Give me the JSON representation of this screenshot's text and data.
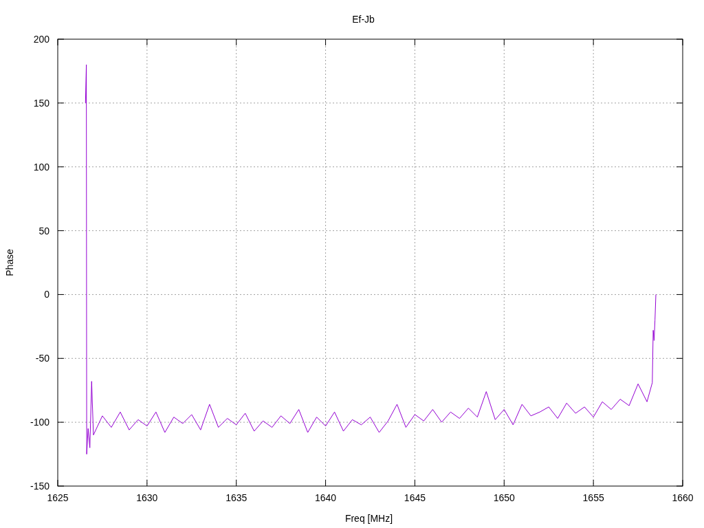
{
  "chart_data": {
    "type": "line",
    "title": "Ef-Jb",
    "xlabel": "Freq [MHz]",
    "ylabel": "Phase",
    "xlim": [
      1625,
      1660
    ],
    "grid": true,
    "ylim": [
      -150,
      200
    ],
    "xticks": [
      1625,
      1630,
      1635,
      1640,
      1645,
      1650,
      1655,
      1660
    ],
    "yticks": [
      -150,
      -100,
      -50,
      0,
      50,
      100,
      150,
      200
    ],
    "x": [
      1626.55,
      1626.6,
      1626.62,
      1626.7,
      1626.8,
      1626.9,
      1627.0,
      1627.5,
      1628,
      1628.5,
      1629,
      1629.5,
      1630,
      1630.5,
      1631,
      1631.5,
      1632,
      1632.5,
      1633,
      1633.5,
      1634,
      1634.5,
      1635,
      1635.5,
      1636,
      1636.5,
      1637,
      1637.5,
      1638,
      1638.5,
      1639,
      1639.5,
      1640,
      1640.5,
      1641,
      1641.5,
      1642,
      1642.5,
      1643,
      1643.5,
      1644,
      1644.5,
      1645,
      1645.5,
      1646,
      1646.5,
      1647,
      1647.5,
      1648,
      1648.5,
      1649,
      1649.5,
      1650,
      1650.5,
      1651,
      1651.5,
      1652,
      1652.5,
      1653,
      1653.5,
      1654,
      1654.5,
      1655,
      1655.5,
      1656,
      1656.5,
      1657,
      1657.5,
      1658,
      1658.3,
      1658.35,
      1658.4,
      1658.45,
      1658.5
    ],
    "series": [
      {
        "color": "#9400d3",
        "values": [
          150,
          180,
          -125,
          -105,
          -120,
          -68,
          -110,
          -95,
          -104,
          -92,
          -106,
          -98,
          -103,
          -92,
          -108,
          -96,
          -101,
          -94,
          -106,
          -86,
          -104,
          -97,
          -102,
          -93,
          -107,
          -99,
          -104,
          -95,
          -101,
          -90,
          -108,
          -96,
          -103,
          -92,
          -107,
          -98,
          -102,
          -96,
          -108,
          -99,
          -86,
          -104,
          -94,
          -99,
          -90,
          -100,
          -92,
          -97,
          -89,
          -96,
          -76,
          -98,
          -90,
          -102,
          -86,
          -95,
          -92,
          -88,
          -97,
          -85,
          -93,
          -88,
          -96,
          -84,
          -90,
          -82,
          -87,
          -70,
          -84,
          -69,
          -28,
          -36,
          -20,
          0
        ]
      }
    ]
  }
}
